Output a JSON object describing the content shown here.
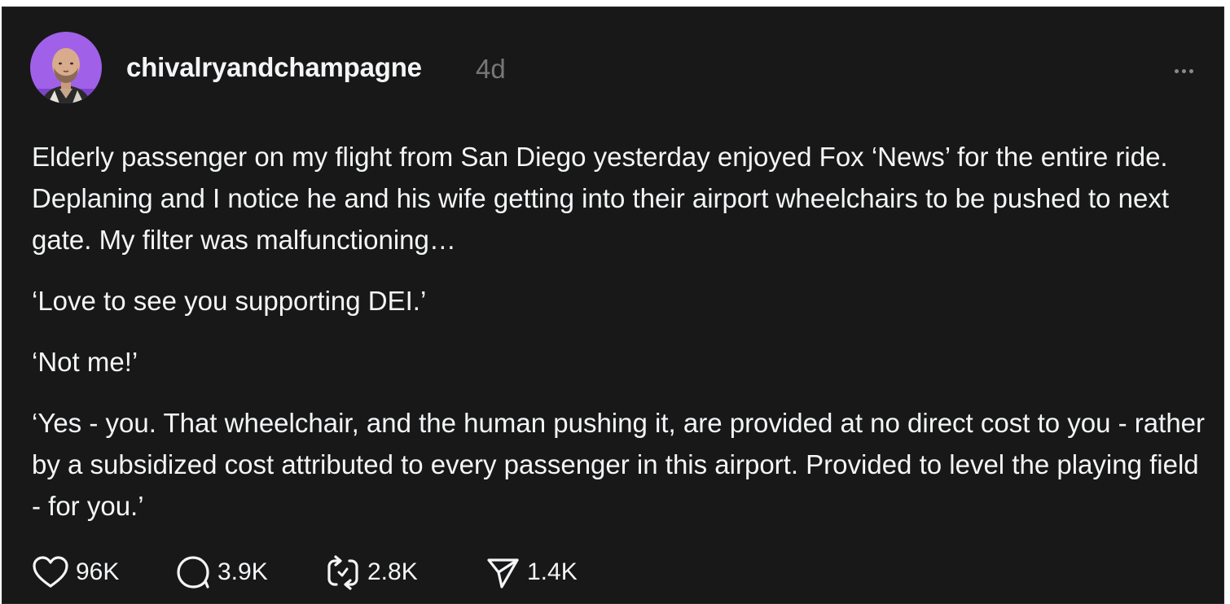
{
  "post": {
    "author": {
      "username": "chivalryandchampagne",
      "timestamp": "4d",
      "avatar_icon": "profile-photo"
    },
    "paragraphs": [
      "Elderly passenger on my flight from San Diego yesterday enjoyed Fox ‘News’ for the entire ride. Deplaning and I notice he and his wife getting into their airport wheelchairs to be pushed to next gate. My filter was malfunctioning…",
      "‘Love to see you supporting DEI.’",
      "‘Not me!’",
      "‘Yes - you. That wheelchair, and the human pushing it, are provided at no direct cost to you - rather by a subsidized cost attributed to every passenger in this airport. Provided to level the playing field - for you.’"
    ],
    "actions": {
      "likes": "96K",
      "replies": "3.9K",
      "reposts": "2.8K",
      "shares": "1.4K"
    }
  },
  "colors": {
    "background": "#181818",
    "text": "#f3f5f7",
    "muted": "#777777",
    "avatar_accent": "#a061e8"
  },
  "icons": [
    "heart-icon",
    "comment-icon",
    "repost-icon",
    "share-icon",
    "more-icon"
  ]
}
